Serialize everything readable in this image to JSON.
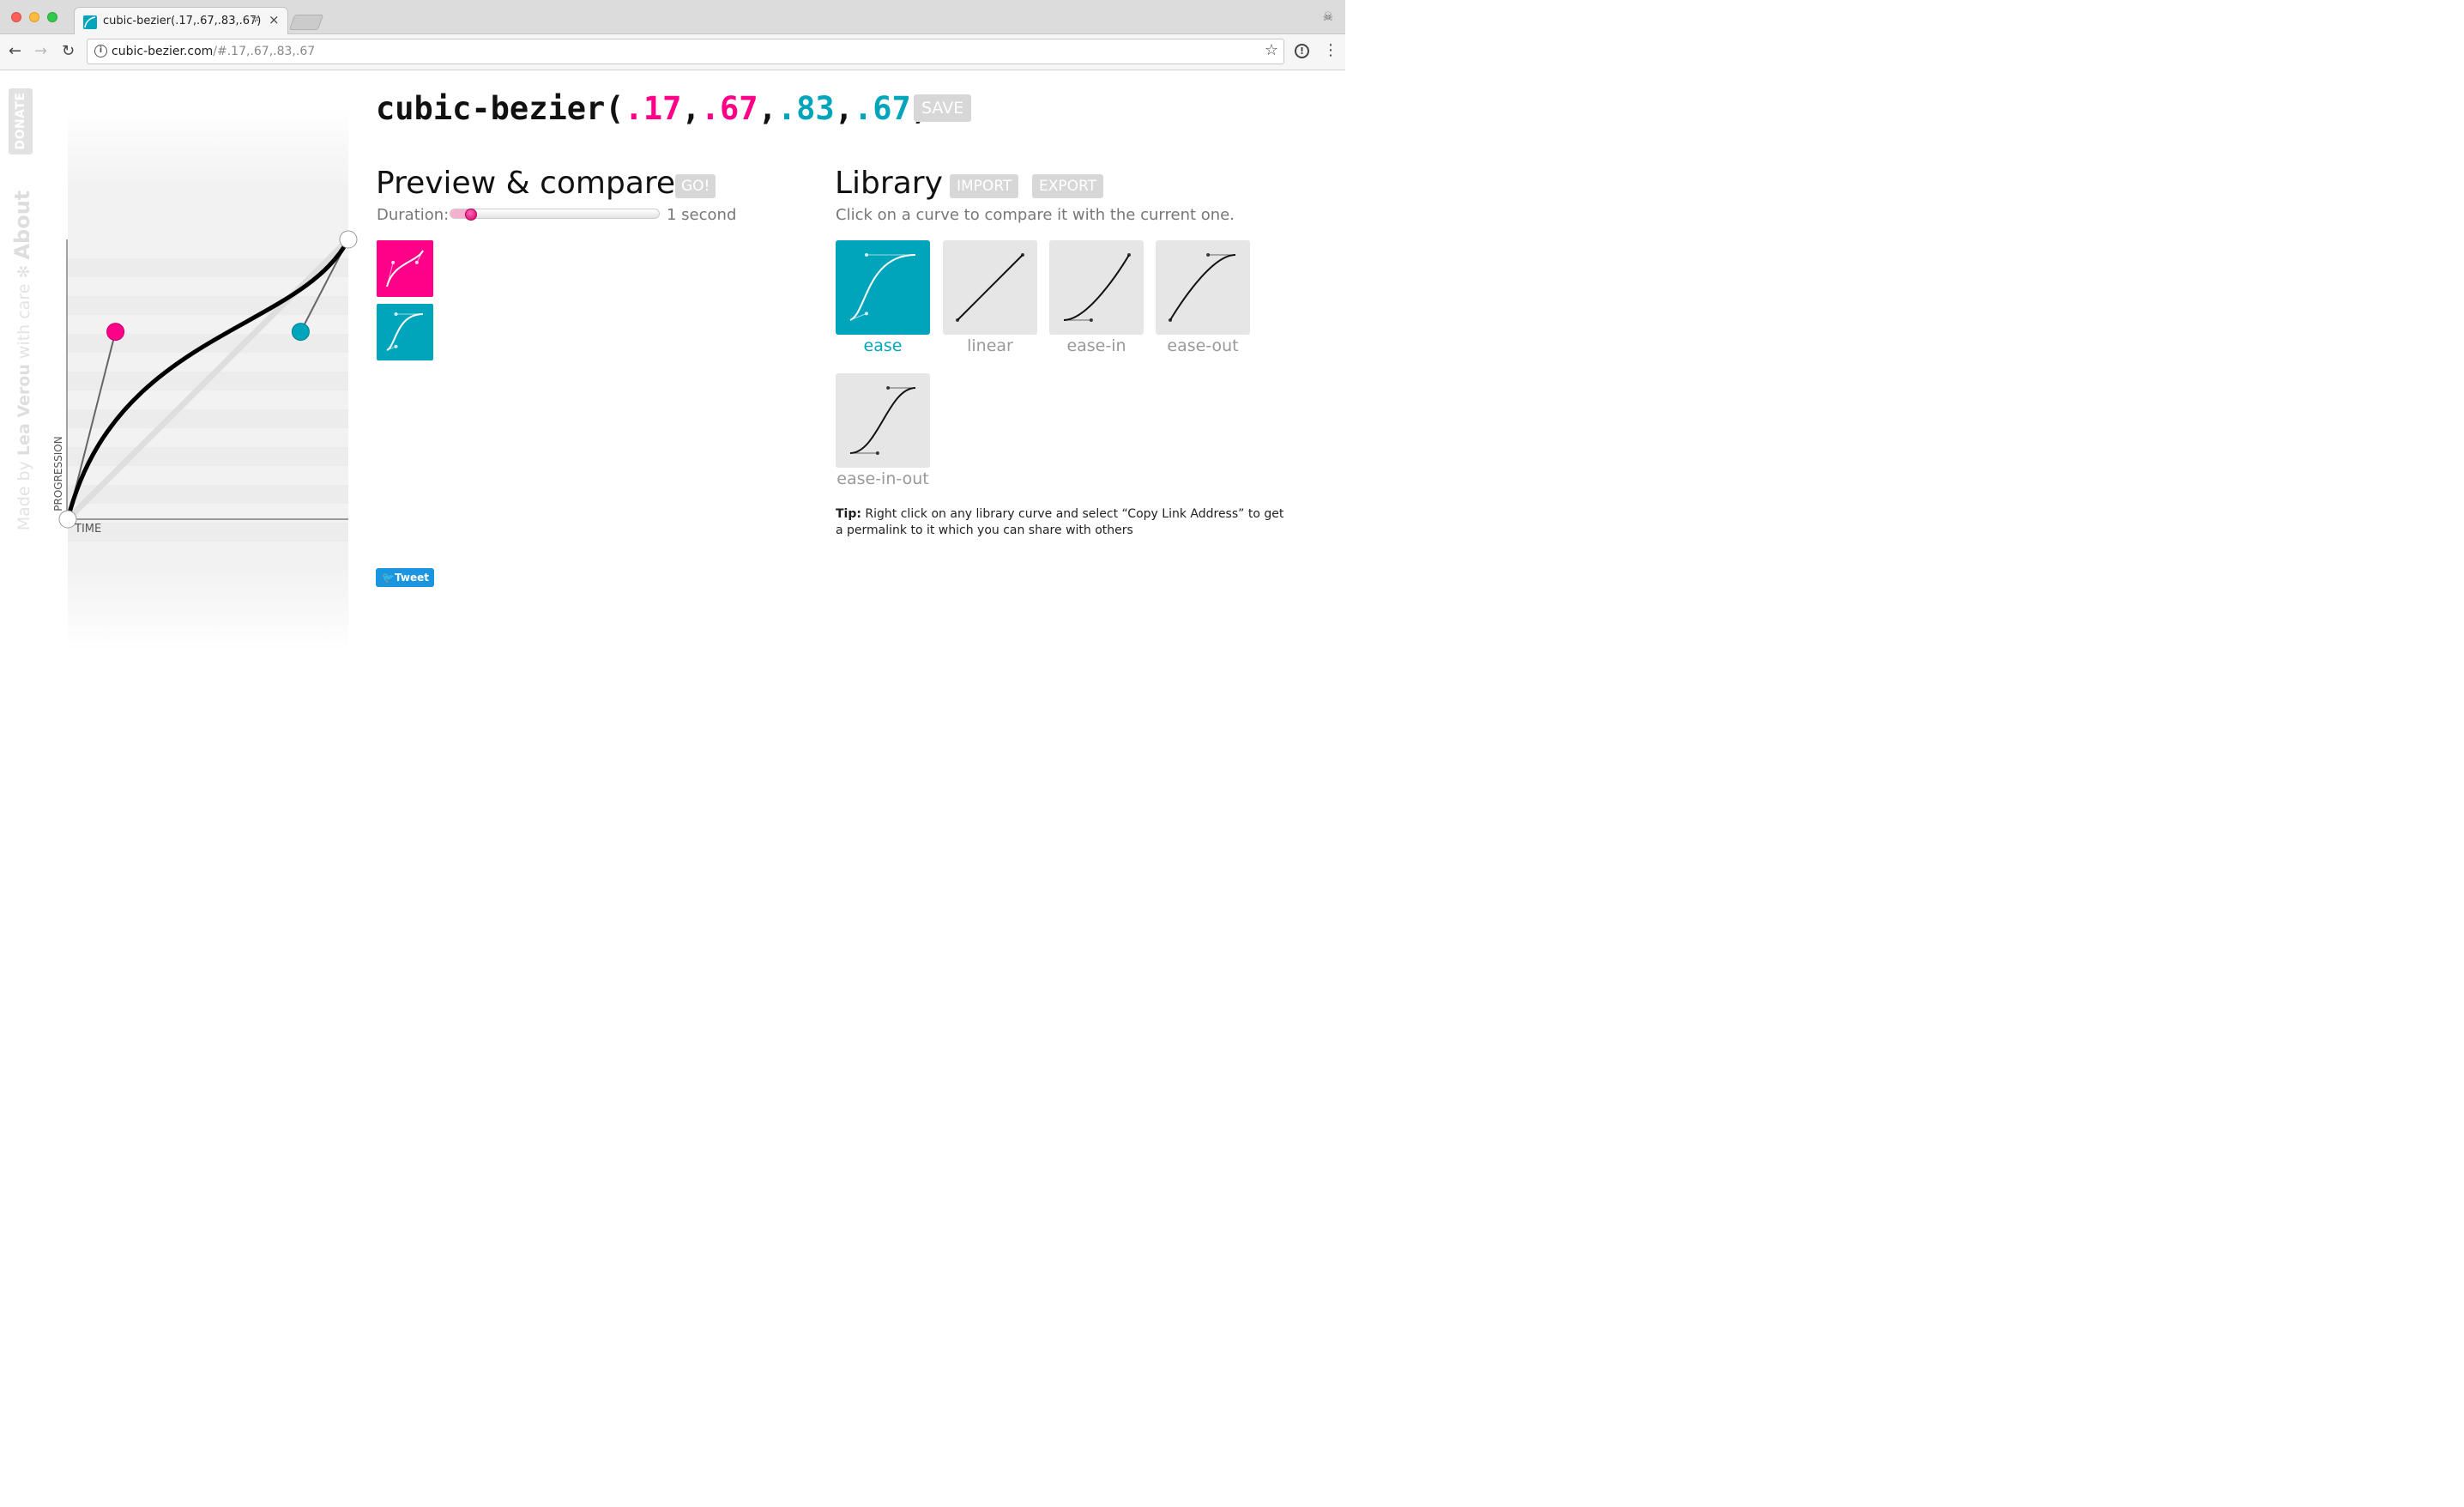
{
  "browser": {
    "tab_title": "cubic-bezier(.17,.67,.83,.67)",
    "tab_close": "×",
    "url_host": "cubic-bezier.com",
    "url_path": "/#.17,.67,.83,.67"
  },
  "sidebar": {
    "donate": "DONATE",
    "made_by": "Made by",
    "author": "Lea Verou",
    "with_care": "with care",
    "separator": "✻",
    "about": "About"
  },
  "graph": {
    "y_axis_label": "PROGRESSION",
    "x_axis_label": "TIME",
    "bezier": [
      0.17,
      0.67,
      0.83,
      0.67
    ],
    "p1_color": "#ff0088",
    "p2_color": "#00a5bc"
  },
  "header": {
    "prefix": "cubic-bezier(",
    "v1": ".17",
    "c1": ",",
    "v2": ".67",
    "c2": ",",
    "v3": ".83",
    "c3": ",",
    "v4": ".67",
    "suffix": ")",
    "save_label": "SAVE"
  },
  "preview": {
    "title": "Preview & compare",
    "go_label": "GO!",
    "duration_label": "Duration:",
    "duration_value": "1 second",
    "duration_fraction": 0.1,
    "current_color": "#ff0088",
    "compare_color": "#00a5bc"
  },
  "library": {
    "title": "Library",
    "import_label": "IMPORT",
    "export_label": "EXPORT",
    "subtitle": "Click on a curve to compare it with the current one.",
    "selected_color": "#00a5bc",
    "items": [
      {
        "name": "ease",
        "bezier": [
          0.25,
          0.1,
          0.25,
          1
        ],
        "selected": true
      },
      {
        "name": "linear",
        "bezier": [
          0,
          0,
          1,
          1
        ],
        "selected": false
      },
      {
        "name": "ease-in",
        "bezier": [
          0.42,
          0,
          1,
          1
        ],
        "selected": false
      },
      {
        "name": "ease-out",
        "bezier": [
          0,
          0,
          0.58,
          1
        ],
        "selected": false
      },
      {
        "name": "ease-in-out",
        "bezier": [
          0.42,
          0,
          0.58,
          1
        ],
        "selected": false
      }
    ]
  },
  "tip": {
    "label": "Tip:",
    "text": "Right click on any library curve and select “Copy Link Address” to get a permalink to it which you can share with others"
  },
  "tweet_label": "Tweet"
}
